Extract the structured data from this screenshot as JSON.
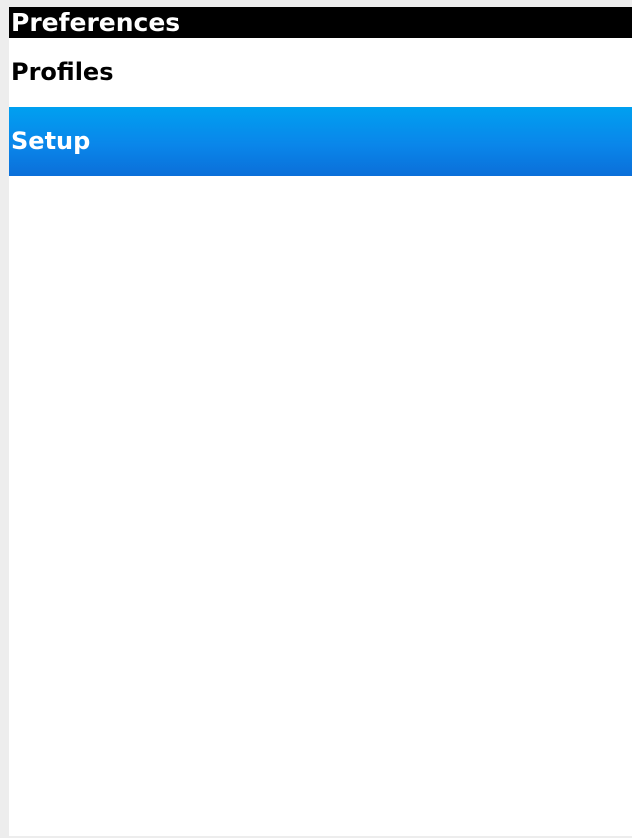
{
  "header": {
    "title": "Preferences"
  },
  "menu": {
    "items": [
      {
        "label": "Profiles",
        "selected": false
      },
      {
        "label": "Setup",
        "selected": true
      }
    ]
  },
  "colors": {
    "title_bar_bg": "#000000",
    "title_text": "#ffffff",
    "selection_highlight_top": "#00a0f0",
    "selection_highlight_bottom": "#0b6fd9",
    "background": "#ffffff"
  }
}
